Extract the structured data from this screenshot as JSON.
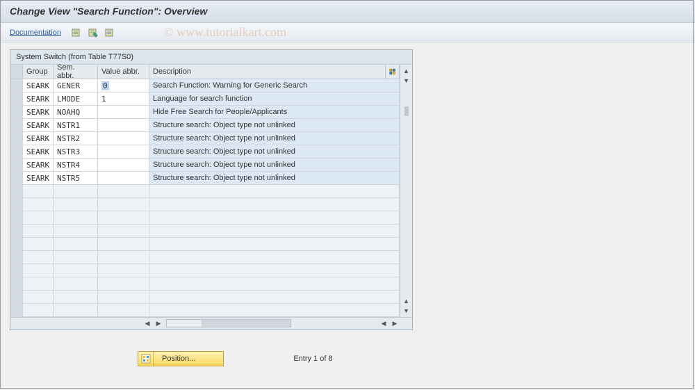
{
  "title": "Change View \"Search Function\": Overview",
  "toolbar": {
    "documentation_label": "Documentation"
  },
  "watermark": "© www.tutorialkart.com",
  "table": {
    "caption": "System Switch (from Table T77S0)",
    "columns": {
      "group": "Group",
      "sem": "Sem. abbr.",
      "val": "Value abbr.",
      "desc": "Description"
    },
    "rows": [
      {
        "group": "SEARK",
        "sem": "GENER",
        "val": "0",
        "desc": "Search Function: Warning for Generic Search",
        "selected": true
      },
      {
        "group": "SEARK",
        "sem": "LMODE",
        "val": "1",
        "desc": "Language for search function"
      },
      {
        "group": "SEARK",
        "sem": "NOAHQ",
        "val": "",
        "desc": "Hide Free Search for People/Applicants"
      },
      {
        "group": "SEARK",
        "sem": "NSTR1",
        "val": "",
        "desc": "Structure search: Object type not unlinked"
      },
      {
        "group": "SEARK",
        "sem": "NSTR2",
        "val": "",
        "desc": "Structure search: Object type not unlinked"
      },
      {
        "group": "SEARK",
        "sem": "NSTR3",
        "val": "",
        "desc": "Structure search: Object type not unlinked"
      },
      {
        "group": "SEARK",
        "sem": "NSTR4",
        "val": "",
        "desc": "Structure search: Object type not unlinked"
      },
      {
        "group": "SEARK",
        "sem": "NSTR5",
        "val": "",
        "desc": "Structure search: Object type not unlinked"
      }
    ],
    "empty_rows": 10
  },
  "footer": {
    "position_label": "Position...",
    "entry_text": "Entry 1 of 8"
  }
}
